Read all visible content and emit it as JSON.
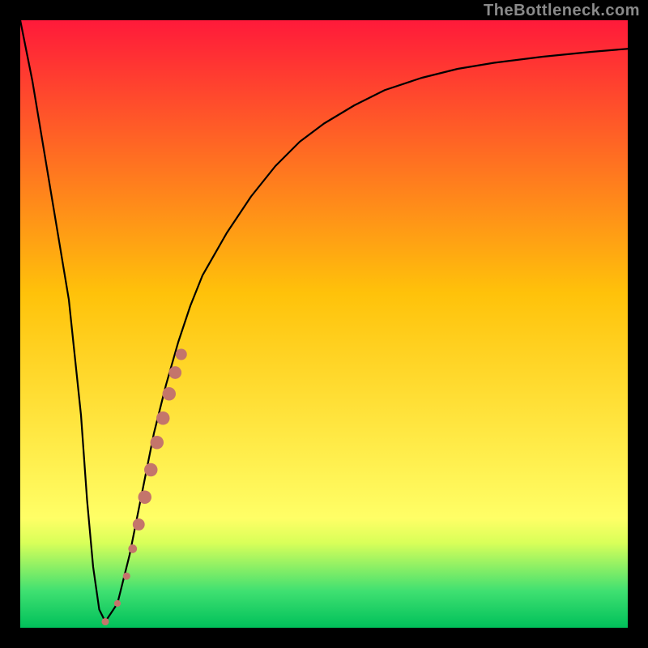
{
  "attribution": "TheBottleneck.com",
  "colors": {
    "border": "#000000",
    "curve": "#000000",
    "dots": "#c4756b",
    "grad_top": "#ff1a3a",
    "grad_mid": "#ffc20a",
    "grad_green_top": "#d9ff59",
    "grad_green_mid": "#3fe071",
    "grad_green_bot": "#00c05a"
  },
  "plot": {
    "inner_x": 25,
    "inner_y": 25,
    "inner_w": 750,
    "inner_h": 750
  },
  "chart_data": {
    "type": "line",
    "title": "",
    "xlabel": "",
    "ylabel": "",
    "xlim": [
      0,
      100
    ],
    "ylim": [
      0,
      100
    ],
    "series": [
      {
        "name": "curve",
        "x": [
          0,
          2,
          4,
          6,
          8,
          10,
          11,
          12,
          13,
          14,
          16,
          18,
          20,
          22,
          24,
          26,
          28,
          30,
          34,
          38,
          42,
          46,
          50,
          55,
          60,
          66,
          72,
          78,
          86,
          94,
          100
        ],
        "y": [
          100,
          90,
          78,
          66,
          54,
          35,
          21,
          10,
          3,
          1,
          4,
          12,
          22,
          32,
          40,
          47,
          53,
          58,
          65,
          71,
          76,
          80,
          83,
          86,
          88.5,
          90.5,
          92,
          93,
          94,
          94.8,
          95.3
        ]
      }
    ],
    "markers": {
      "name": "highlight-dots",
      "color_key": "colors.dots",
      "points": [
        {
          "x": 14.0,
          "y": 1.0,
          "r": 1.1
        },
        {
          "x": 16.0,
          "y": 4.0,
          "r": 1.0
        },
        {
          "x": 17.5,
          "y": 8.5,
          "r": 1.1
        },
        {
          "x": 18.5,
          "y": 13.0,
          "r": 1.3
        },
        {
          "x": 19.5,
          "y": 17.0,
          "r": 1.8
        },
        {
          "x": 20.5,
          "y": 21.5,
          "r": 2.0
        },
        {
          "x": 21.5,
          "y": 26.0,
          "r": 2.0
        },
        {
          "x": 22.5,
          "y": 30.5,
          "r": 2.0
        },
        {
          "x": 23.5,
          "y": 34.5,
          "r": 2.0
        },
        {
          "x": 24.5,
          "y": 38.5,
          "r": 2.0
        },
        {
          "x": 25.5,
          "y": 42.0,
          "r": 1.9
        },
        {
          "x": 26.5,
          "y": 45.0,
          "r": 1.7
        }
      ]
    }
  }
}
